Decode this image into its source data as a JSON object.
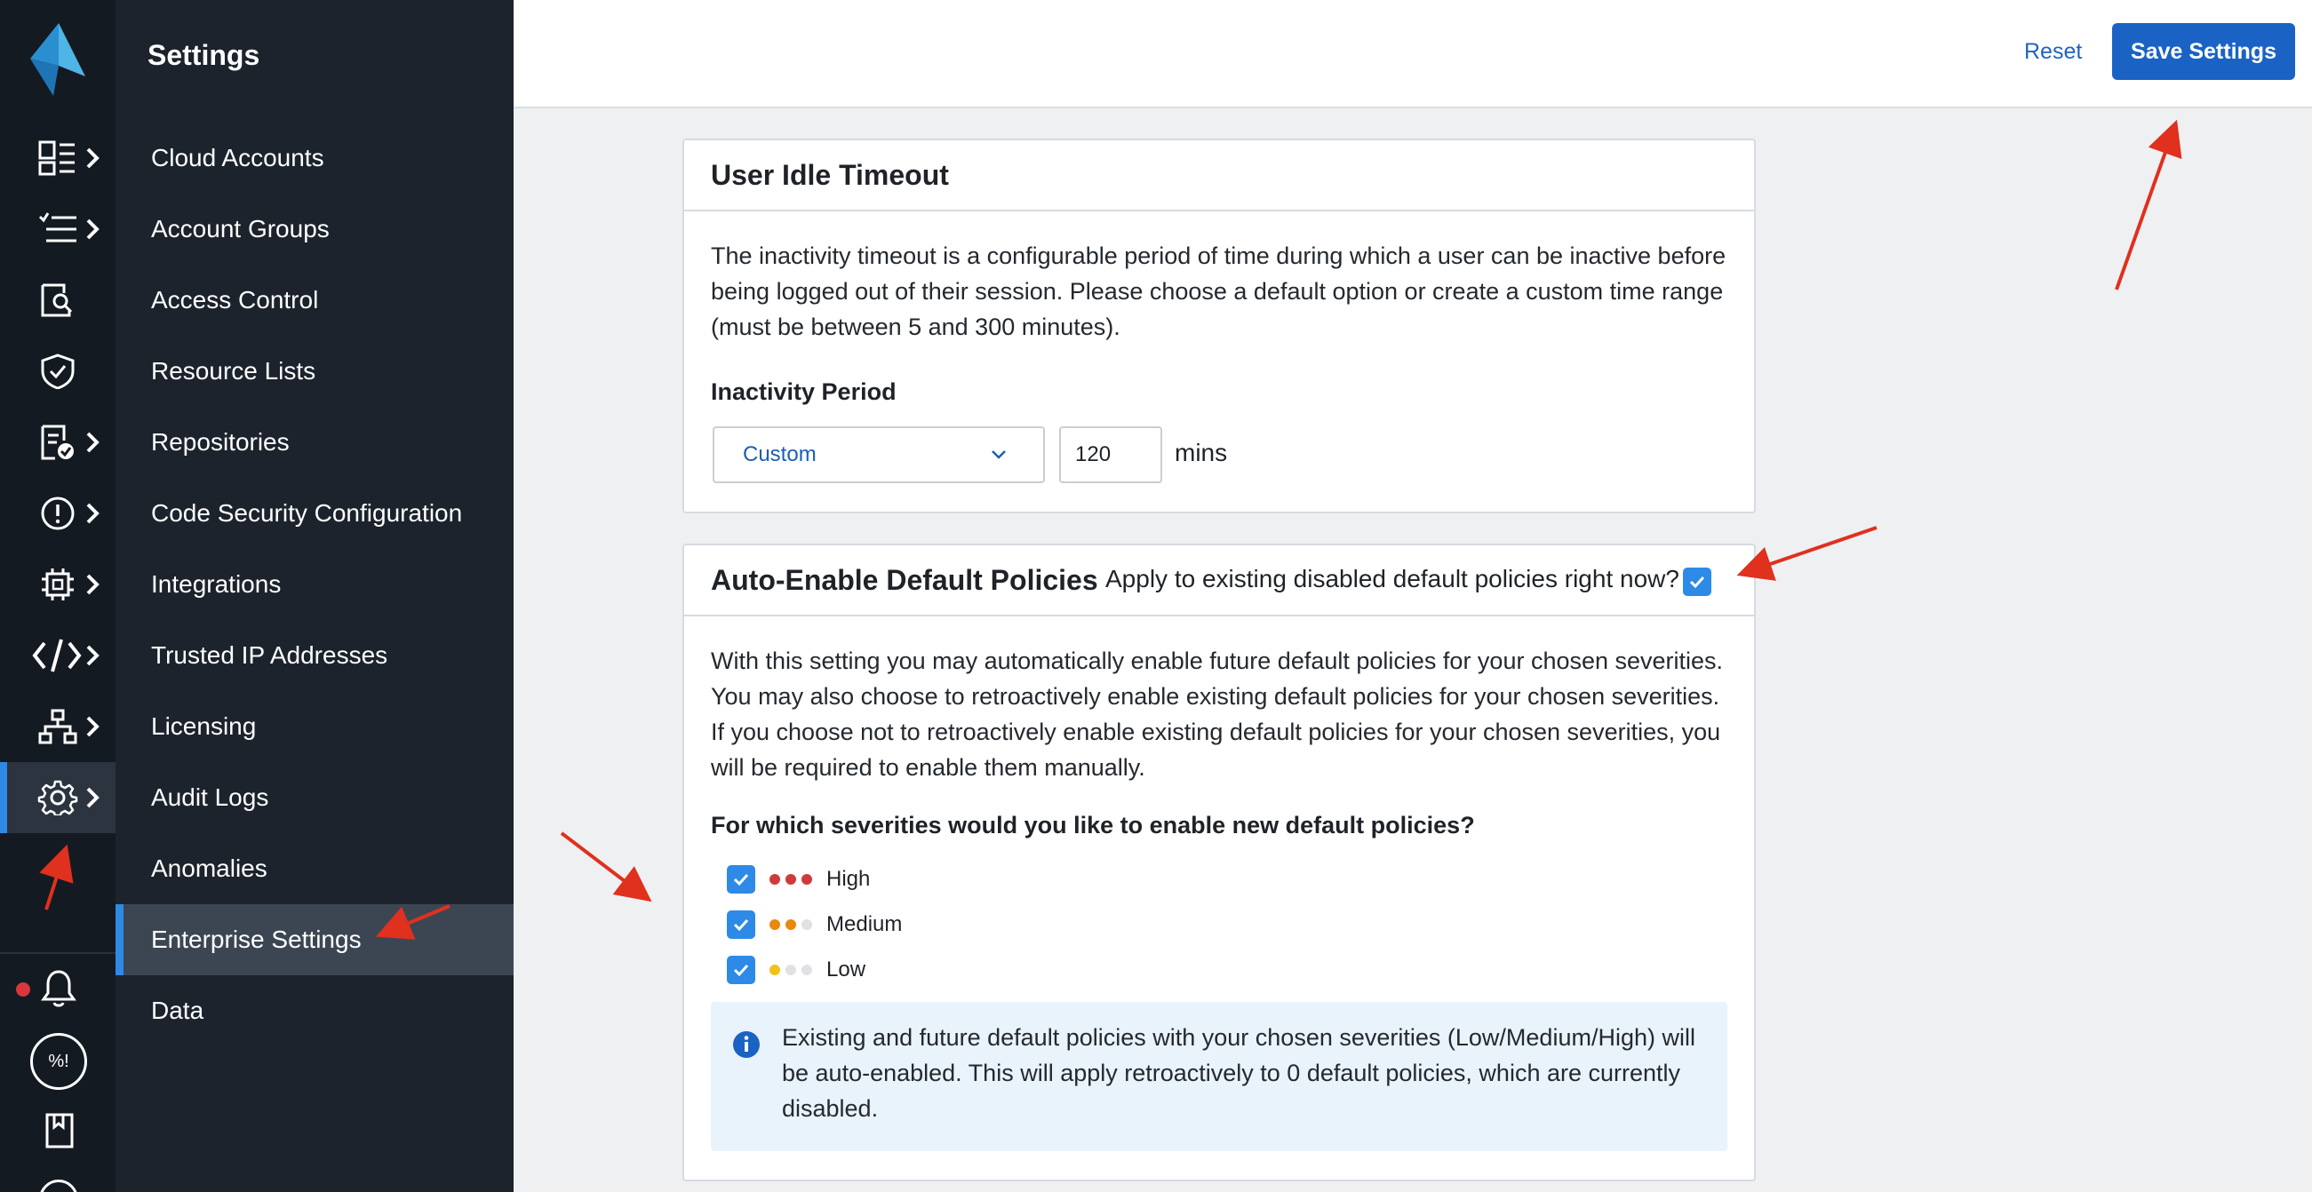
{
  "menu": {
    "title": "Settings",
    "items": [
      {
        "label": "Cloud Accounts"
      },
      {
        "label": "Account Groups"
      },
      {
        "label": "Access Control"
      },
      {
        "label": "Resource Lists"
      },
      {
        "label": "Repositories"
      },
      {
        "label": "Code Security Configuration"
      },
      {
        "label": "Integrations"
      },
      {
        "label": "Trusted IP Addresses"
      },
      {
        "label": "Licensing"
      },
      {
        "label": "Audit Logs"
      },
      {
        "label": "Anomalies"
      },
      {
        "label": "Enterprise Settings",
        "active": true
      },
      {
        "label": "Data"
      }
    ]
  },
  "rail": {
    "icons": [
      "dashboard-icon",
      "list-icon",
      "search-document-icon",
      "shield-check-icon",
      "report-check-icon",
      "alert-icon",
      "chip-icon",
      "code-icon",
      "network-icon",
      "gear-icon"
    ],
    "badge_label": "%!",
    "notification_color": "#d9363e"
  },
  "toolbar": {
    "reset_label": "Reset",
    "save_label": "Save Settings"
  },
  "idle_timeout": {
    "title": "User Idle Timeout",
    "description": "The inactivity timeout is a configurable period of time during which a user can be inactive before being logged out of their session. Please choose a default option or create a custom time range (must be between 5 and 300 minutes).",
    "period_label": "Inactivity Period",
    "selected_option": "Custom",
    "minutes_value": "120",
    "unit": "mins"
  },
  "auto_enable": {
    "title": "Auto-Enable Default Policies",
    "apply_label": "Apply to existing disabled default policies right now?",
    "apply_checked": true,
    "description": "With this setting you may automatically enable future default policies for your chosen severities. You may also choose to retroactively enable existing default policies for your chosen severities. If you choose not to retroactively enable existing default policies for your chosen severities, you will be required to enable them manually.",
    "question": "For which severities would you like to enable new default policies?",
    "severities": [
      {
        "label": "High",
        "checked": true,
        "color": "#d03a3a",
        "filled": 3
      },
      {
        "label": "Medium",
        "checked": true,
        "color": "#e8890c",
        "filled": 2
      },
      {
        "label": "Low",
        "checked": true,
        "color": "#f2c21b",
        "filled": 1
      }
    ],
    "info": "Existing and future default policies with your chosen severities (Low/Medium/High) will be auto-enabled. This will apply retroactively to 0 default policies, which are currently disabled."
  },
  "colors": {
    "accent": "#1a63c4",
    "checkbox": "#2d8ae6",
    "annotation": "#e0301e"
  }
}
